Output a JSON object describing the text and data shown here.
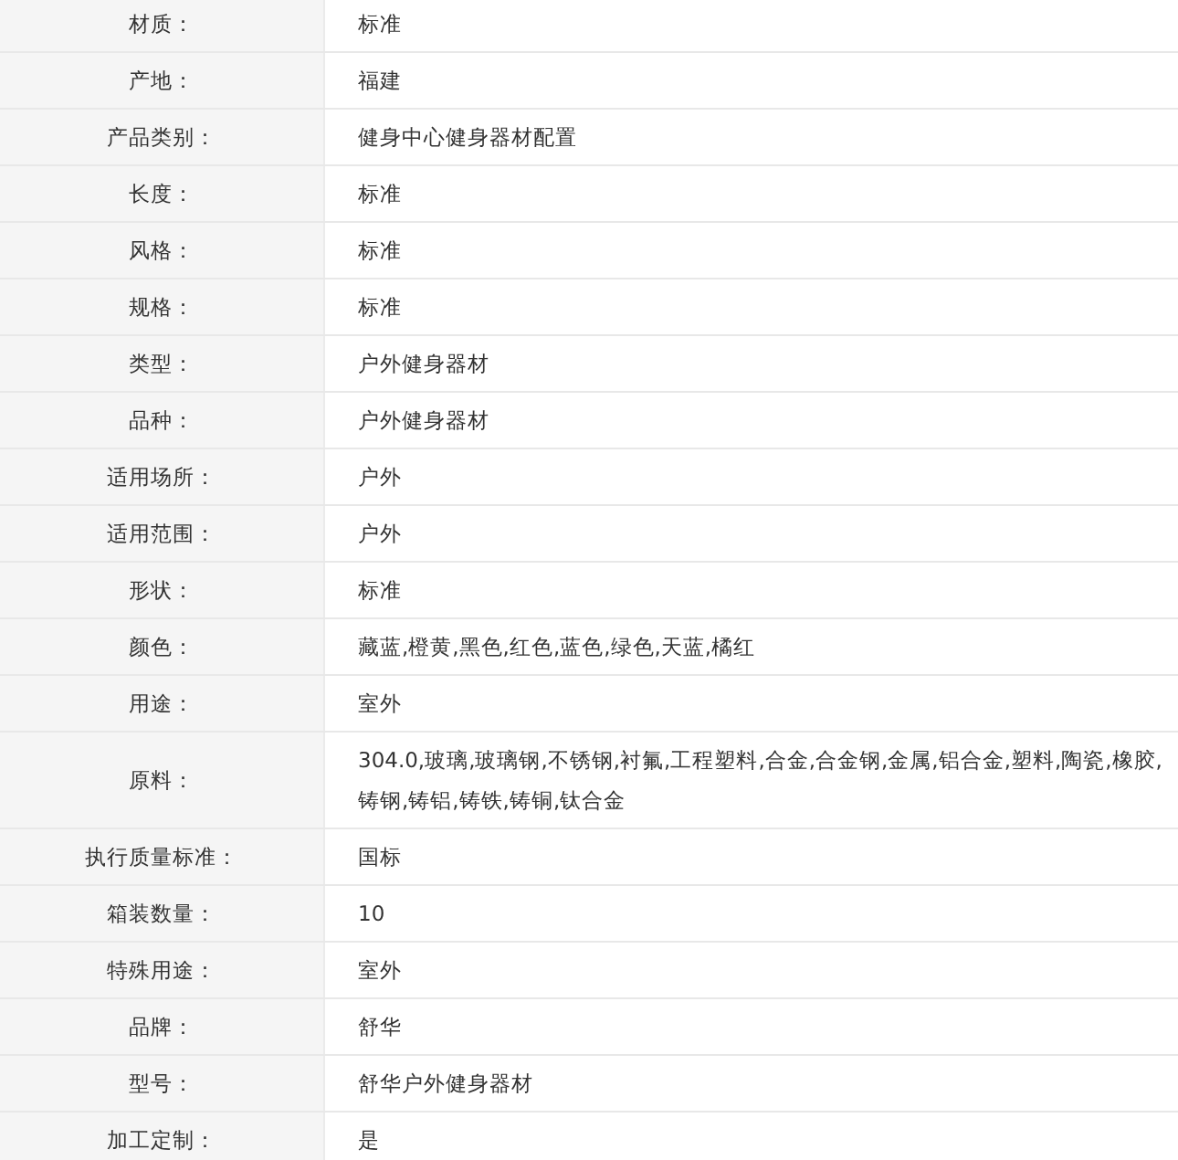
{
  "attributes": [
    {
      "label": "材质：",
      "value": "标准"
    },
    {
      "label": "产地：",
      "value": "福建"
    },
    {
      "label": "产品类别：",
      "value": "健身中心健身器材配置"
    },
    {
      "label": "长度：",
      "value": "标准"
    },
    {
      "label": "风格：",
      "value": "标准"
    },
    {
      "label": "规格：",
      "value": "标准"
    },
    {
      "label": "类型：",
      "value": "户外健身器材"
    },
    {
      "label": "品种：",
      "value": "户外健身器材"
    },
    {
      "label": "适用场所：",
      "value": "户外"
    },
    {
      "label": "适用范围：",
      "value": "户外"
    },
    {
      "label": "形状：",
      "value": "标准"
    },
    {
      "label": "颜色：",
      "value": "藏蓝,橙黄,黑色,红色,蓝色,绿色,天蓝,橘红"
    },
    {
      "label": "用途：",
      "value": "室外"
    },
    {
      "label": "原料：",
      "value": "304.0,玻璃,玻璃钢,不锈钢,衬氟,工程塑料,合金,合金钢,金属,铝合金,塑料,陶瓷,橡胶,铸钢,铸铝,铸铁,铸铜,钛合金"
    },
    {
      "label": "执行质量标准：",
      "value": "国标"
    },
    {
      "label": "箱装数量：",
      "value": "10"
    },
    {
      "label": "特殊用途：",
      "value": "室外"
    },
    {
      "label": "品牌：",
      "value": "舒华"
    },
    {
      "label": "型号：",
      "value": "舒华户外健身器材"
    },
    {
      "label": "加工定制：",
      "value": "是"
    }
  ]
}
